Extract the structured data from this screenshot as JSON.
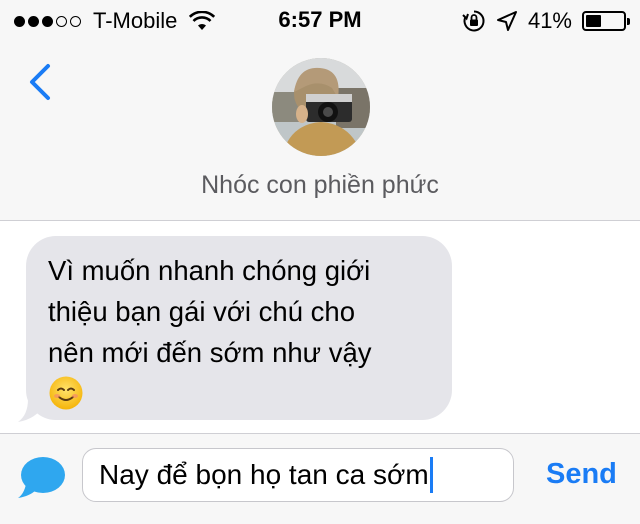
{
  "status_bar": {
    "carrier": "T-Mobile",
    "time": "6:57 PM",
    "battery_text": "41%",
    "battery_level": 0.41,
    "signal_bars_filled": 3,
    "signal_bars_total": 5,
    "icons": [
      "wifi-icon",
      "orientation-lock-icon",
      "location-arrow-icon",
      "battery-icon"
    ]
  },
  "header": {
    "back_icon": "chevron-left-icon",
    "contact_name": "Nhóc con phiền phức"
  },
  "messages": [
    {
      "direction": "incoming",
      "lines": [
        "Vì muốn nhanh chóng giới",
        "thiệu bạn gái với chú cho",
        "nên mới đến sớm như vậy"
      ],
      "emoji": "☺️"
    }
  ],
  "composer": {
    "text": "Nay để bọn họ tan ca sớm",
    "send_label": "Send",
    "chat_icon": "speech-bubble-icon"
  },
  "colors": {
    "accent": "#1a7cf5",
    "bubble_incoming": "#e5e5ea",
    "chrome": "#f7f7f7"
  }
}
